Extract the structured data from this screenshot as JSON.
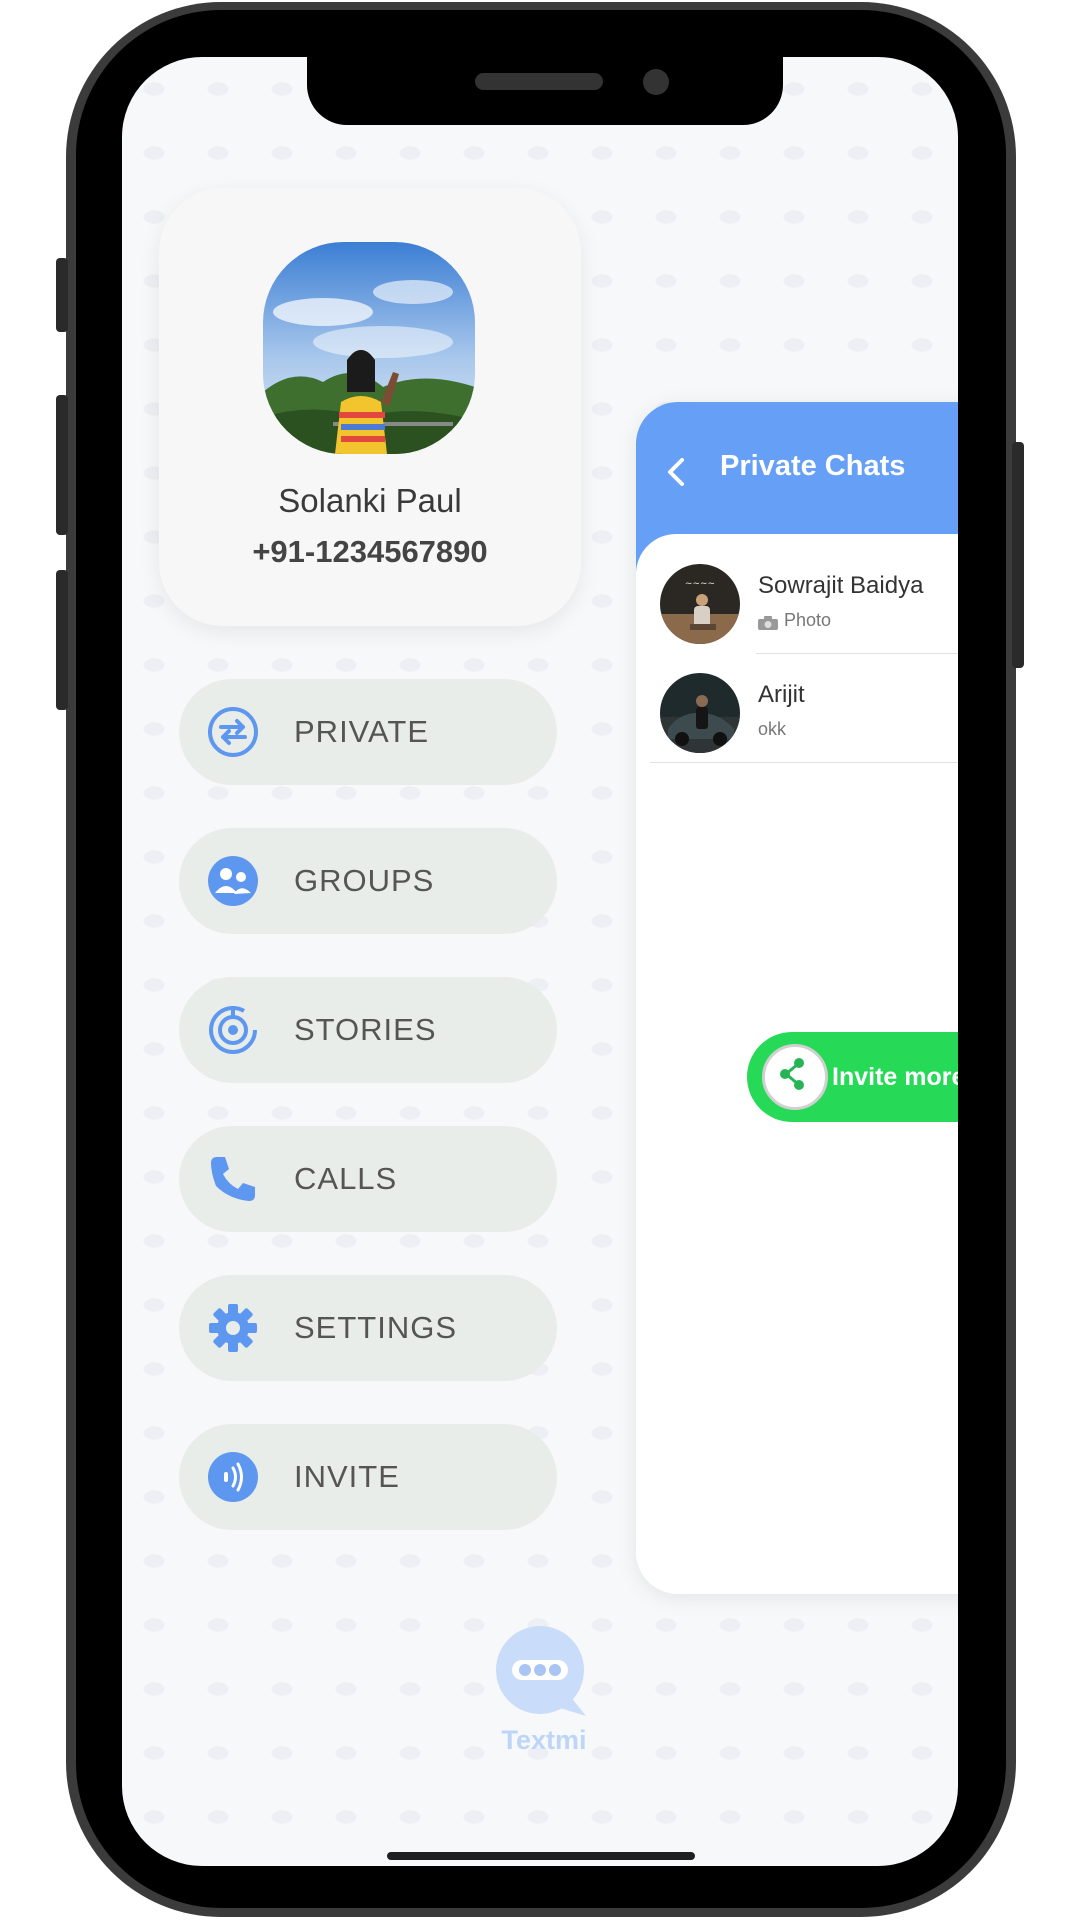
{
  "profile": {
    "name": "Solanki Paul",
    "phone": "+91-1234567890"
  },
  "menu": {
    "items": [
      {
        "label": "PRIVATE",
        "icon": "swap-arrows-icon"
      },
      {
        "label": "GROUPS",
        "icon": "group-icon"
      },
      {
        "label": "STORIES",
        "icon": "stories-icon"
      },
      {
        "label": "CALLS",
        "icon": "phone-icon"
      },
      {
        "label": "SETTINGS",
        "icon": "gear-icon"
      },
      {
        "label": "INVITE",
        "icon": "broadcast-icon"
      }
    ]
  },
  "chat_panel": {
    "title": "Private Chats",
    "chats": [
      {
        "name": "Sowrajit Baidya",
        "preview": "Photo",
        "preview_icon": "camera-icon"
      },
      {
        "name": "Arijit",
        "preview": "okk"
      }
    ],
    "invite_label": "Invite more"
  },
  "brand": {
    "name": "Textmi"
  },
  "colors": {
    "accent_blue": "#659ff6",
    "menu_bg": "#e9ede9",
    "invite_green": "#26d957",
    "logo_light_blue": "#bdd6f7"
  }
}
